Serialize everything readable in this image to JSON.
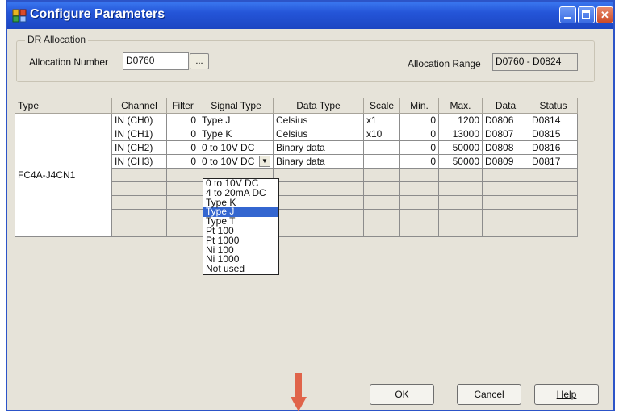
{
  "window": {
    "title": "Configure Parameters"
  },
  "allocation": {
    "group_label": "DR Allocation",
    "number_label": "Allocation Number",
    "number_value": "D0760",
    "browse_label": "...",
    "range_label": "Allocation Range",
    "range_value": "D0760 - D0824"
  },
  "table": {
    "headers": [
      "Type",
      "Channel",
      "Filter",
      "Signal Type",
      "Data Type",
      "Scale",
      "Min.",
      "Max.",
      "Data",
      "Status"
    ],
    "type_value": "FC4A-J4CN1",
    "rows": [
      {
        "channel": "IN (CH0)",
        "filter": "0",
        "signal": "Type J",
        "data_type": "Celsius",
        "scale": "x1",
        "min": "0",
        "max": "1200",
        "data": "D0806",
        "status": "D0814"
      },
      {
        "channel": "IN (CH1)",
        "filter": "0",
        "signal": "Type K",
        "data_type": "Celsius",
        "scale": "x10",
        "min": "0",
        "max": "13000",
        "data": "D0807",
        "status": "D0815"
      },
      {
        "channel": "IN (CH2)",
        "filter": "0",
        "signal": "0 to 10V DC",
        "data_type": "Binary data",
        "scale": "",
        "min": "0",
        "max": "50000",
        "data": "D0808",
        "status": "D0816"
      },
      {
        "channel": "IN (CH3)",
        "filter": "0",
        "signal": "0 to 10V DC",
        "data_type": "Binary data",
        "scale": "",
        "min": "0",
        "max": "50000",
        "data": "D0809",
        "status": "D0817"
      }
    ]
  },
  "dropdown": {
    "options": [
      "0 to 10V DC",
      "4 to 20mA DC",
      "Type K",
      "Type J",
      "Type T",
      "Pt 100",
      "Pt 1000",
      "Ni 100",
      "Ni 1000",
      "Not used"
    ],
    "selected": "Type J"
  },
  "buttons": {
    "ok": "OK",
    "cancel": "Cancel",
    "help": "Help"
  },
  "colors": {
    "title_bar": "#2455d8",
    "selection": "#3466d0",
    "marker_arrow": "#e0644a"
  }
}
